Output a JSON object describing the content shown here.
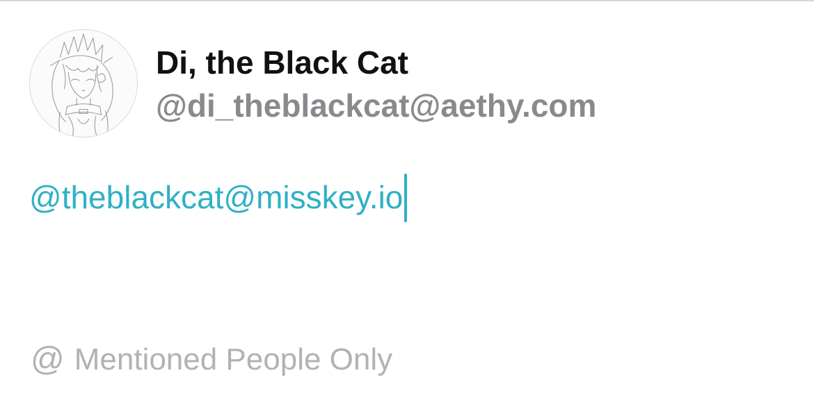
{
  "account": {
    "display_name": "Di, the Black Cat",
    "handle": "@di_theblackcat@aethy.com",
    "avatar_icon": "avatar-sketch-icon"
  },
  "compose": {
    "text": "@theblackcat@misskey.io",
    "text_color": "#2fb0c6"
  },
  "visibility": {
    "icon_name": "at-sign-icon",
    "icon_glyph": "@",
    "label": "Mentioned People Only",
    "color": "#b2b2b2"
  },
  "colors": {
    "handle": "#8a8a8e",
    "name": "#111111"
  }
}
